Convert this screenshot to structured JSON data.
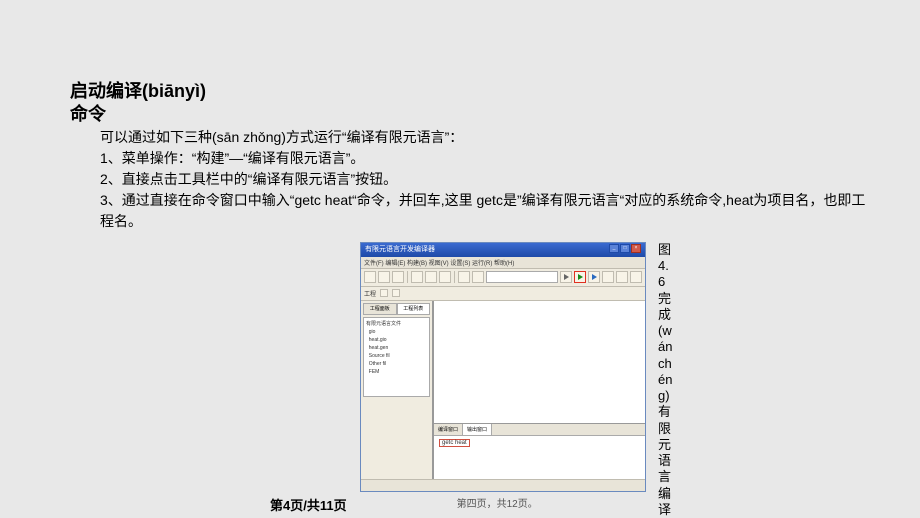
{
  "title_line1": "启动编译(biānyì)",
  "title_line2": "命令",
  "para_intro": "可以通过如下三种(sān zhǒng)方式运行“编译有限元语言”：",
  "para_1": "1、菜单操作：“构建”—“编译有限元语言”。",
  "para_2": "2、直接点击工具栏中的“编译有限元语言”按钮。",
  "para_3": "3、通过直接在命令窗口中输入“getc  heat“命令，并回车,这里 getc是”编译有限元语言“对应的系统命令,heat为项目名，也即工程名。",
  "caption": "图4.6 完成(wánchéng)有限元语言编译",
  "footer_left": "第4页/共11页",
  "footer_right": "第四页，共12页。",
  "app": {
    "title": "有限元语言开发编译器",
    "menu": "文件(F)  编辑(E)  构建(B)  视图(V)  设置(S)  运行(R)  帮助(H)",
    "toolbar2_label": "工程",
    "sp_tab_active": "工程面板",
    "sp_tab_other": "工程列表",
    "tree": "有限元语言文件\n  gio\n  heat.gio\n  heat.gen\n  Source fil\n  Other fil\n  FEM",
    "out_tab1": "编译窗口",
    "out_tab2": "输出窗口",
    "cmd": "getc heat"
  }
}
